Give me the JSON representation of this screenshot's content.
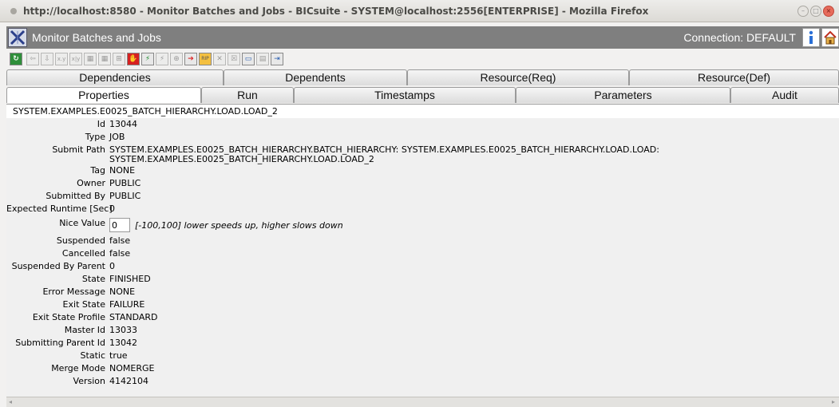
{
  "window": {
    "title": "http://localhost:8580 - Monitor Batches and Jobs - BICsuite - SYSTEM@localhost:2556[ENTERPRISE] - Mozilla Firefox"
  },
  "app": {
    "name": "Monitor Batches and Jobs",
    "connection": "Connection: DEFAULT"
  },
  "toolbar": {
    "icons": [
      "refresh-icon",
      "back-icon",
      "download-icon",
      "x-y-icon",
      "x-y-icon",
      "grid-icon",
      "grid-icon",
      "grid-icon",
      "stop-hand-icon",
      "run-icon",
      "run-disabled-icon",
      "target-icon",
      "arrow-right-icon",
      "rip-icon",
      "close-icon",
      "close-all-icon",
      "comment-icon",
      "save-icon",
      "exit-icon"
    ]
  },
  "tabs_row1": [
    {
      "label": "Dependencies"
    },
    {
      "label": "Dependents"
    },
    {
      "label": "Resource(Req)"
    },
    {
      "label": "Resource(Def)"
    }
  ],
  "tabs_row2": [
    {
      "label": "Properties",
      "active": true
    },
    {
      "label": "Run"
    },
    {
      "label": "Timestamps"
    },
    {
      "label": "Parameters"
    },
    {
      "label": "Audit"
    }
  ],
  "properties": {
    "path": "SYSTEM.EXAMPLES.E0025_BATCH_HIERARCHY.LOAD.LOAD_2",
    "id_label": "Id",
    "id": "13044",
    "type_label": "Type",
    "type": "JOB",
    "submit_path_label": "Submit Path",
    "submit_path_line1": "SYSTEM.EXAMPLES.E0025_BATCH_HIERARCHY.BATCH_HIERARCHY: SYSTEM.EXAMPLES.E0025_BATCH_HIERARCHY.LOAD.LOAD:",
    "submit_path_line2": "SYSTEM.EXAMPLES.E0025_BATCH_HIERARCHY.LOAD.LOAD_2",
    "tag_label": "Tag",
    "tag": "NONE",
    "owner_label": "Owner",
    "owner": "PUBLIC",
    "submitted_by_label": "Submitted By",
    "submitted_by": "PUBLIC",
    "expected_runtime_label": "Expected Runtime [Sec]",
    "expected_runtime": "0",
    "nice_value_label": "Nice Value",
    "nice_value": "0",
    "nice_hint": "[-100,100] lower speeds up, higher slows down",
    "suspended_label": "Suspended",
    "suspended": "false",
    "cancelled_label": "Cancelled",
    "cancelled": "false",
    "suspended_by_parent_label": "Suspended By Parent",
    "suspended_by_parent": "0",
    "state_label": "State",
    "state": "FINISHED",
    "error_message_label": "Error Message",
    "error_message": "NONE",
    "exit_state_label": "Exit State",
    "exit_state": "FAILURE",
    "exit_state_profile_label": "Exit State Profile",
    "exit_state_profile": "STANDARD",
    "master_id_label": "Master Id",
    "master_id": "13033",
    "submitting_parent_id_label": "Submitting Parent Id",
    "submitting_parent_id": "13042",
    "static_label": "Static",
    "static": "true",
    "merge_mode_label": "Merge Mode",
    "merge_mode": "NOMERGE",
    "version_label": "Version",
    "version": "4142104"
  }
}
